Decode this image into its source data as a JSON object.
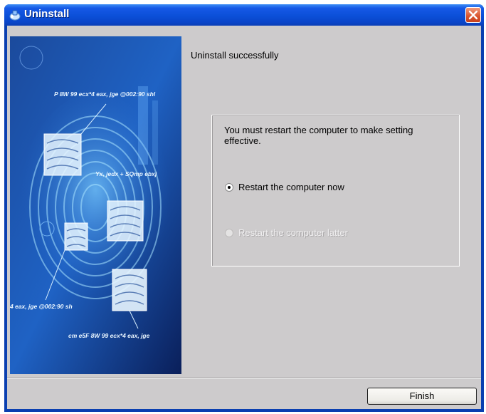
{
  "window": {
    "title": "Uninstall",
    "title_icon": "installer-icon",
    "close_icon": "close-icon",
    "accent_color": "#0b4fd8",
    "close_color": "#d9542d"
  },
  "side_image": {
    "description_icon": "fingerprint-banner",
    "captions": [
      "P 8W 99 ecx*4 eax, jge @002:90 shl",
      "Yx, jedx + SQmp ebxj",
      "4 eax, jge @002:90 sh",
      "cm e5F 8W 99 ecx*4 eax, jge"
    ]
  },
  "main": {
    "status": "Uninstall successfully",
    "message": "You must restart the computer to make setting effective.",
    "options": [
      {
        "label": "Restart the computer now",
        "selected": true,
        "enabled": true
      },
      {
        "label": "Restart the computer latter",
        "selected": false,
        "enabled": false
      }
    ]
  },
  "footer": {
    "finish_label": "Finish"
  }
}
